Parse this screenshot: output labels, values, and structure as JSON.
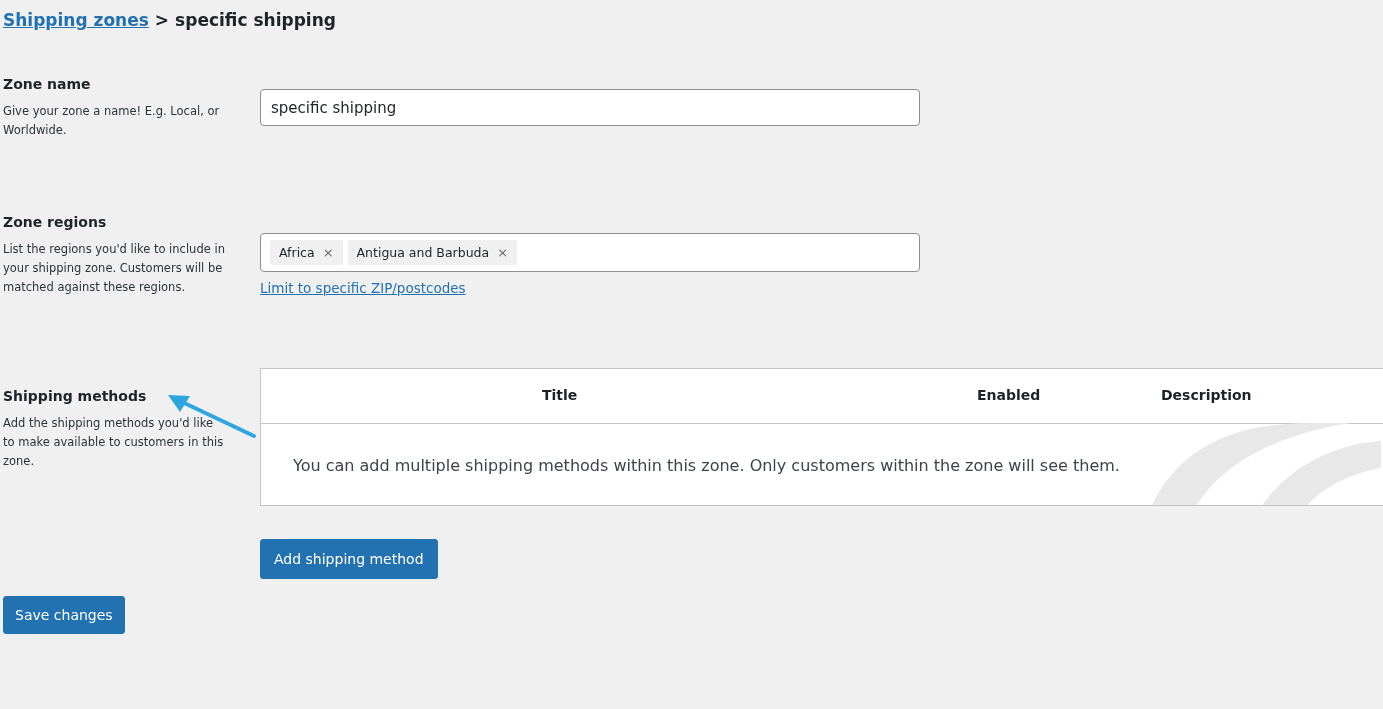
{
  "breadcrumb": {
    "link": "Shipping zones",
    "separator": ">",
    "current": "specific shipping"
  },
  "zone_name": {
    "label": "Zone name",
    "description": "Give your zone a name! E.g. Local, or Worldwide.",
    "value": "specific shipping"
  },
  "zone_regions": {
    "label": "Zone regions",
    "description": "List the regions you'd like to include in your shipping zone. Customers will be matched against these regions.",
    "tags": [
      {
        "label": "Africa",
        "remove": "×"
      },
      {
        "label": "Antigua and Barbuda",
        "remove": "×"
      }
    ],
    "link": "Limit to specific ZIP/postcodes"
  },
  "shipping_methods": {
    "label": "Shipping methods",
    "description": "Add the shipping methods you'd like to make available to customers in this zone.",
    "table": {
      "columns": [
        "Title",
        "Enabled",
        "Description"
      ],
      "empty_message": "You can add multiple shipping methods within this zone. Only customers within the zone will see them."
    },
    "add_button": "Add shipping method"
  },
  "save_button": "Save changes"
}
